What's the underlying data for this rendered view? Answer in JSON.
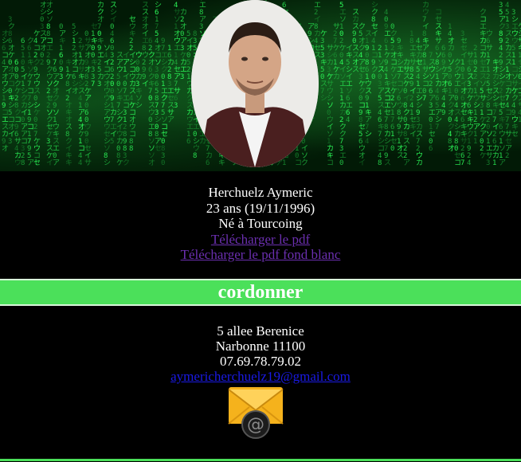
{
  "profile": {
    "name": "Herchuelz Aymeric",
    "age": "23 ans (19/11/1996)",
    "birthplace": "Né à Tourcoing",
    "pdf_link": "Télécharger le pdf",
    "pdf_white_link": "Télécharger le pdf fond blanc"
  },
  "section": {
    "title": "cordonner"
  },
  "contact": {
    "address_line1": "5 allee Berenice",
    "address_line2": "Narbonne 11100",
    "phone": "07.69.78.79.02",
    "email": "aymericherchuelz19@gmail.com",
    "email_icon": "envelope-at-icon"
  },
  "colors": {
    "background": "#000000",
    "accent_green": "#4be05a",
    "visited_link": "#6b2fb0",
    "link": "#1a1ae6"
  }
}
